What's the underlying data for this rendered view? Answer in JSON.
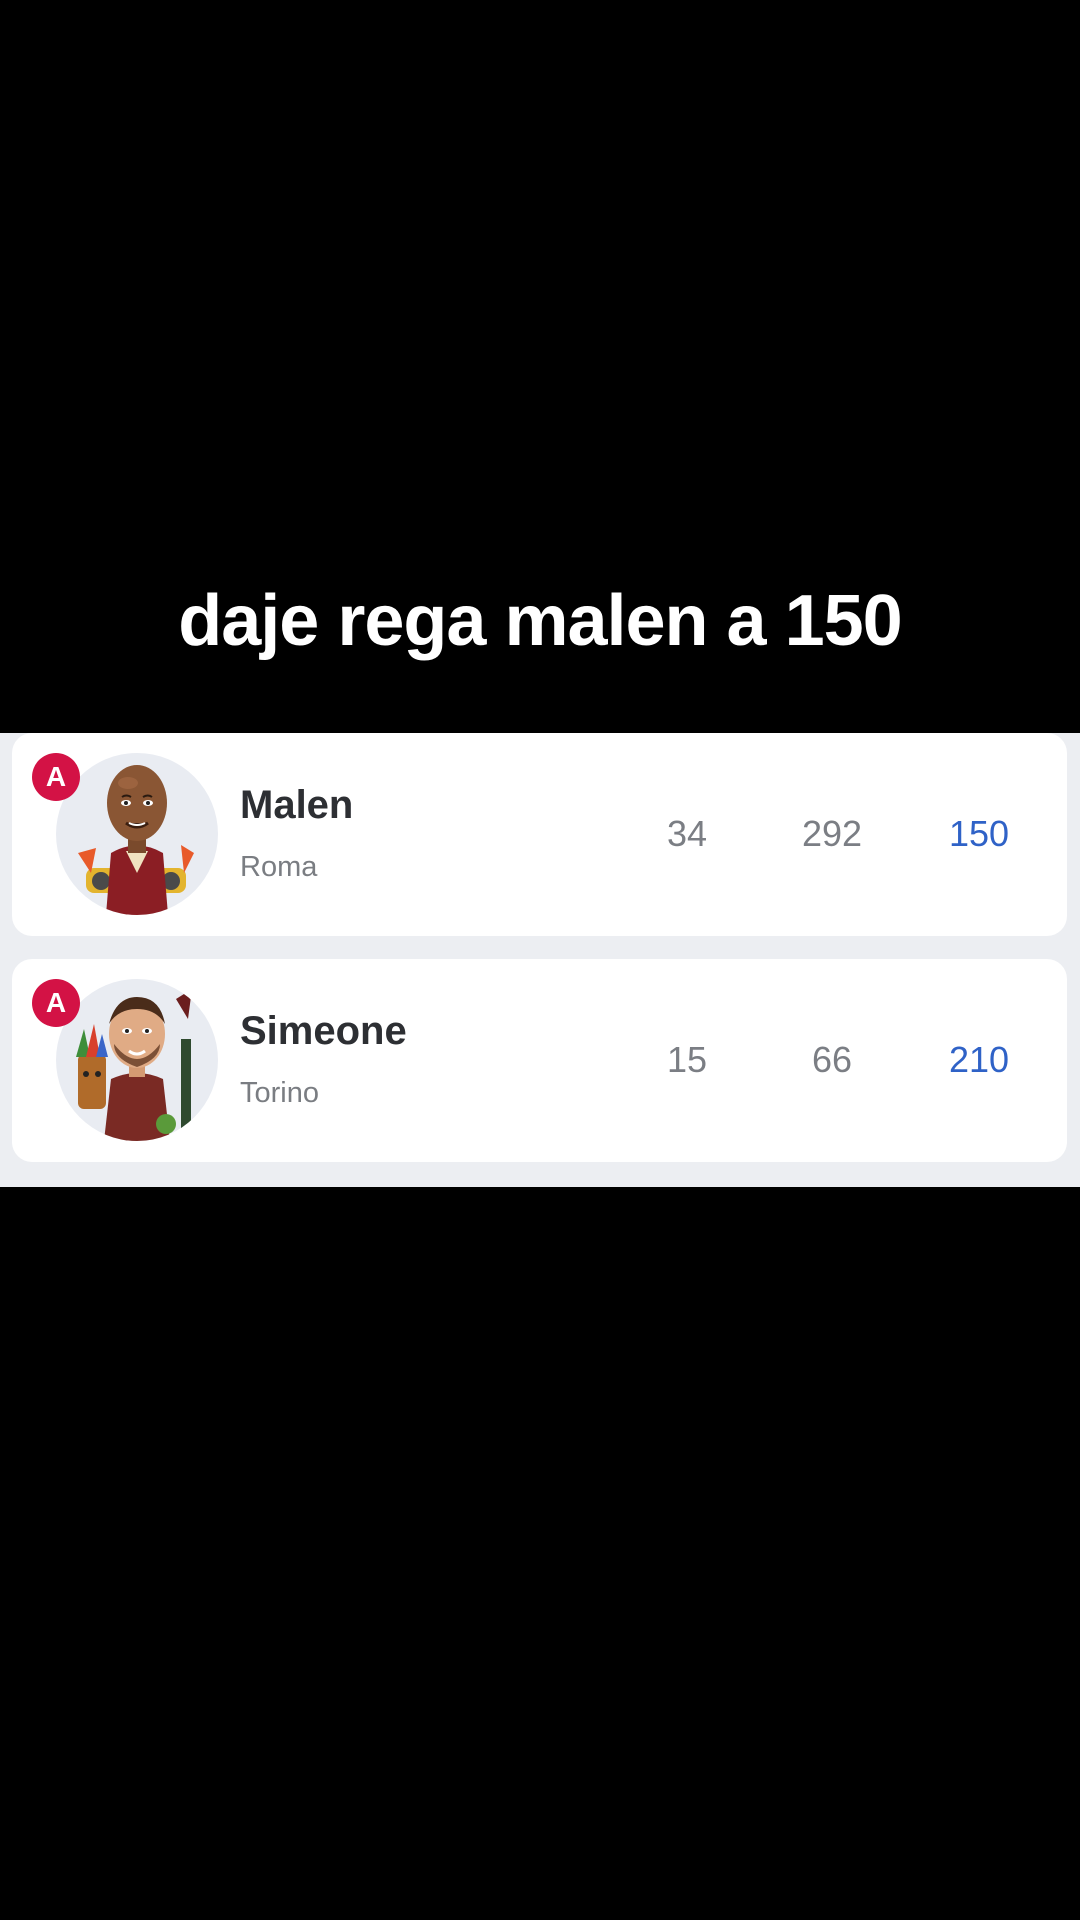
{
  "caption": "daje rega malen a 150",
  "players": [
    {
      "badge": "A",
      "name": "Malen",
      "team": "Roma",
      "stat1": "34",
      "stat2": "292",
      "stat3": "150"
    },
    {
      "badge": "A",
      "name": "Simeone",
      "team": "Torino",
      "stat1": "15",
      "stat2": "66",
      "stat3": "210"
    }
  ],
  "colors": {
    "badge": "#d31245",
    "highlight_stat": "#2f62c7",
    "panel_bg": "#eceef2"
  }
}
